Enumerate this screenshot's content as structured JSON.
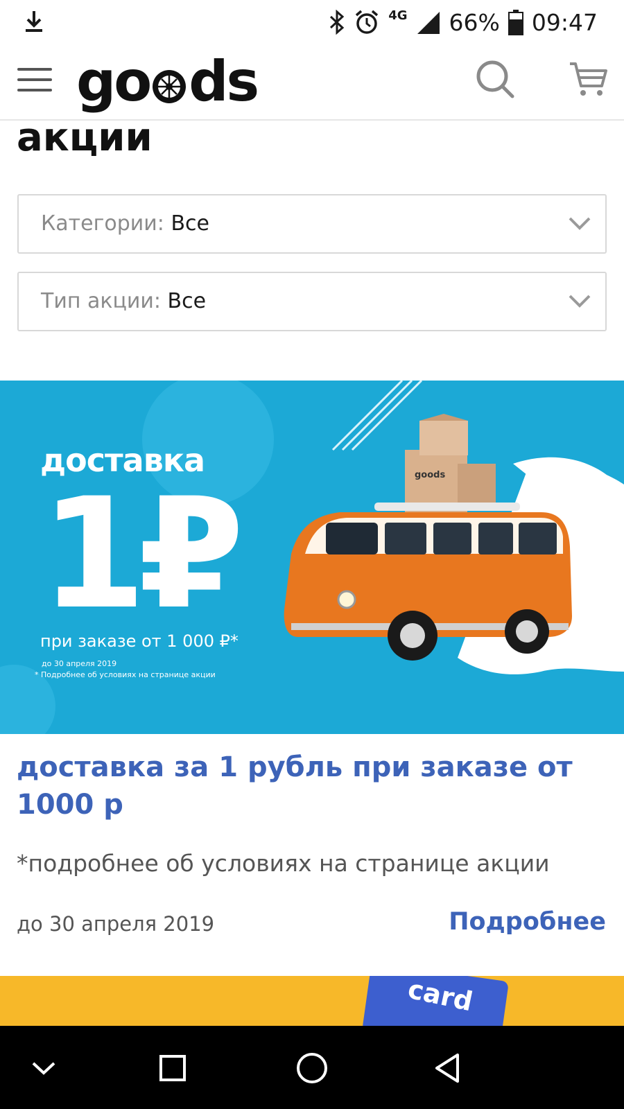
{
  "status_bar": {
    "network": "4G",
    "battery": "66%",
    "time": "09:47",
    "icons": [
      "download-icon",
      "bluetooth-icon",
      "alarm-icon",
      "signal-icon",
      "battery-icon"
    ]
  },
  "header": {
    "logo": "goods",
    "icons": [
      "menu-icon",
      "search-icon",
      "cart-icon"
    ]
  },
  "page": {
    "title": "акции"
  },
  "filters": {
    "category": {
      "label": "Категории:",
      "value": "Все"
    },
    "promo_type": {
      "label": "Тип акции:",
      "value": "Все"
    }
  },
  "banner": {
    "line1": "доставка",
    "price": "1₽",
    "sub": "при заказе от 1 000 ₽*",
    "tiny1": "до 30 апреля 2019",
    "tiny2": "* Подробнее об условиях на странице акции",
    "box_label": "goods",
    "colors": {
      "background": "#1ca9d6",
      "van": "#e8771f"
    }
  },
  "promo": {
    "title": "доставка за 1 рубль при заказе от 1000 р",
    "note": "*подробнее об условиях на странице акции",
    "date": "до 30 апреля 2019",
    "more_link": "Подробнее",
    "accent_color": "#3d63b8"
  },
  "banner2": {
    "card_label": "card",
    "background": "#f7b829"
  },
  "navbar": {
    "icons": [
      "chevron-down-icon",
      "recent-apps-icon",
      "home-icon",
      "back-icon"
    ]
  }
}
